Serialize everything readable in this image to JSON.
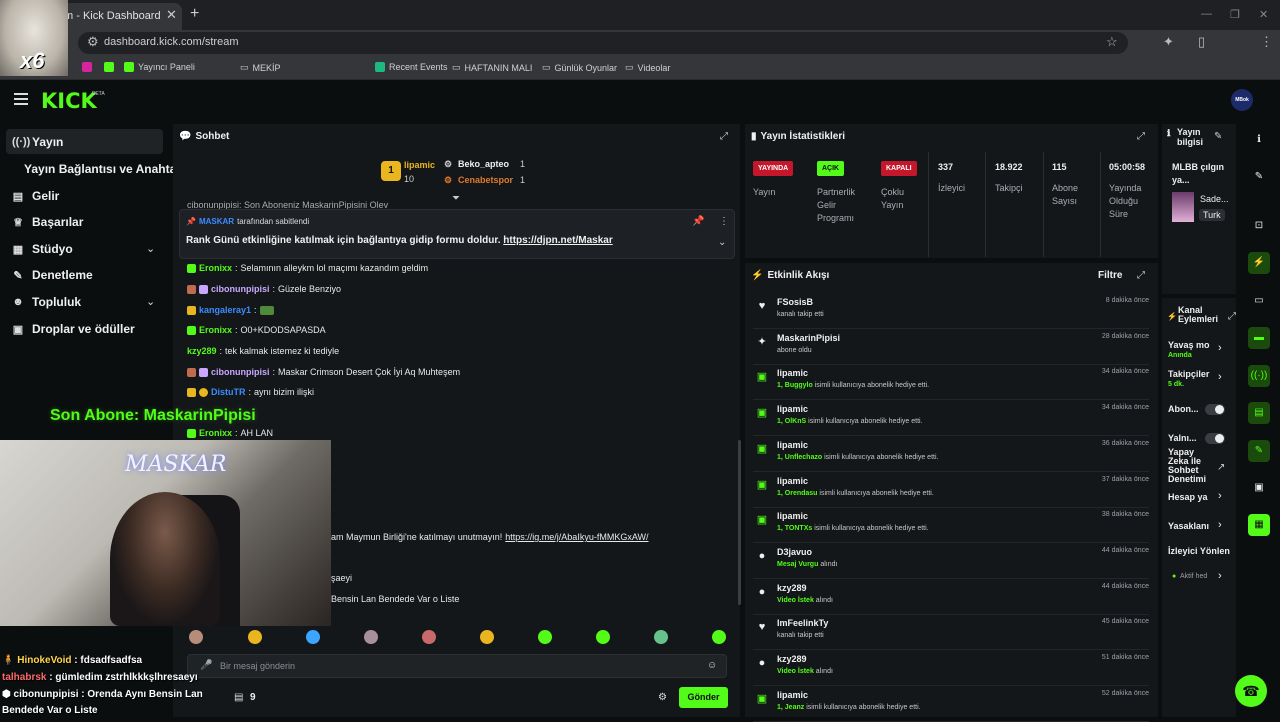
{
  "browser": {
    "tab_title": "m - Kick Dashboard",
    "url": "dashboard.kick.com/stream",
    "bookmarks": [
      "Yayıncı Paneli",
      "MEKİP",
      "Recent Events",
      "HAFTANIN MALI",
      "Günlük Oyunlar",
      "Videolar"
    ]
  },
  "app": {
    "logo": "KICK",
    "logo_beta": "BETA",
    "account_avatar": "MBok"
  },
  "sidebar": {
    "items": [
      {
        "label": "Yayın",
        "icon": "broadcast-icon"
      },
      {
        "label": "Yayın Bağlantısı ve Anahtarı",
        "icon": ""
      },
      {
        "label": "Gelir",
        "icon": "wallet-icon"
      },
      {
        "label": "Başarılar",
        "icon": "trophy-icon"
      },
      {
        "label": "Stüdyo",
        "icon": "studio-icon"
      },
      {
        "label": "Denetleme",
        "icon": "wrench-icon"
      },
      {
        "label": "Topluluk",
        "icon": "people-icon"
      },
      {
        "label": "Droplar ve ödüller",
        "icon": "gift-icon"
      }
    ]
  },
  "chat": {
    "title": "Sohbet",
    "top_gifters": {
      "rank": "1",
      "first": {
        "name": "lipamic",
        "count": "10"
      },
      "second": {
        "name": "Beko_apteo",
        "count": "1"
      },
      "third": {
        "name": "Cenabetspor",
        "count": "1"
      }
    },
    "cut_line": "cibonunpipisi: Son Aboneniz MaskarinPipisini Olev",
    "pinned": {
      "by_user": "MASKAR",
      "by_text": "tarafından sabitlendi",
      "message": "Rank Günü etkinliğine katılmak için bağlantıya gidip formu doldur. ",
      "link": "https://djpn.net/Maskar"
    },
    "messages": [
      {
        "user": "Eronixx",
        "text": "Selamının alleykm lol maçımı kazandım geldim",
        "color": "#53fc18"
      },
      {
        "user": "cibonunpipisi",
        "text": "Güzele Benziyo",
        "color": "#c9a7ff"
      },
      {
        "user": "kangaleray1",
        "text": "",
        "color": "#3b8cff"
      },
      {
        "user": "Eronixx",
        "text": "O0+KDODSAPASDA",
        "color": "#53fc18"
      },
      {
        "user": "kzy289",
        "text": "tek kalmak istemez ki tediyle",
        "color": "#53fc18"
      },
      {
        "user": "cibonunpipisi",
        "text": "Maskar Crimson Desert Çok İyi Aq Muhteşem",
        "color": "#c9a7ff"
      },
      {
        "user": "DistuTR",
        "text": "aynı bizim ilişki",
        "color": "#3b8cff"
      },
      {
        "user": "Eronixx",
        "text": "AH LAN",
        "color": "#53fc18"
      }
    ],
    "partial_lines": [
      {
        "text": "am Maymun Birliği'ne katılmayı unutmayın! ",
        "link": "https://ig.me/j/AbaIkyu-fMMKGxAW/"
      },
      {
        "text": "şaeyi",
        "link": ""
      },
      {
        "text": "Bensin Lan Bendede Var o Liste",
        "link": ""
      }
    ],
    "input_placeholder": "Bir mesaj gönderin",
    "points": "9",
    "send_label": "Gönder"
  },
  "stats": {
    "title": "Yayın İstatistikleri",
    "live_badge": "YAYINDA",
    "live_label": "Yayın",
    "partner_badge": "AÇIK",
    "partner_label": "Partnerlik Gelir Programı",
    "multi_badge": "KAPALI",
    "multi_label": "Çoklu Yayın",
    "viewers": "337",
    "viewers_label": "İzleyici",
    "followers": "18.922",
    "followers_label": "Takipçi",
    "subs": "115",
    "subs_label": "Abone Sayısı",
    "duration": "05:00:58",
    "duration_label": "Yayında Olduğu Süre"
  },
  "activity": {
    "title": "Etkinlik Akışı",
    "filter": "Filtre",
    "items": [
      {
        "icon": "heart-icon",
        "name": "FSosisB",
        "desc": "kanalı takip etti",
        "hl": "",
        "time": "8 dakika önce"
      },
      {
        "icon": "sparkle-icon",
        "name": "MaskarinPipisi",
        "desc": "abone oldu",
        "hl": "",
        "time": "28 dakika önce"
      },
      {
        "icon": "gift-icon",
        "name": "lipamic",
        "hl": "1, Buggylo",
        "desc": " isimli kullanıcıya abonelik hediye etti.",
        "time": "34 dakika önce"
      },
      {
        "icon": "gift-icon",
        "name": "lipamic",
        "hl": "1, OlKnS",
        "desc": " isimli kullanıcıya abonelik hediye etti.",
        "time": "34 dakika önce"
      },
      {
        "icon": "gift-icon",
        "name": "lipamic",
        "hl": "1, Unflechazo",
        "desc": " isimli kullanıcıya abonelik hediye etti.",
        "time": "36 dakika önce"
      },
      {
        "icon": "gift-icon",
        "name": "lipamic",
        "hl": "1, Orendasu",
        "desc": " isimli kullanıcıya abonelik hediye etti.",
        "time": "37 dakika önce"
      },
      {
        "icon": "gift-icon",
        "name": "lipamic",
        "hl": "1, TONTXs",
        "desc": " isimli kullanıcıya abonelik hediye etti.",
        "time": "38 dakika önce"
      },
      {
        "icon": "points-icon",
        "name": "D3javuo",
        "hl": "Mesaj Vurgu",
        "desc": " alındı",
        "time": "44 dakika önce"
      },
      {
        "icon": "points-icon",
        "name": "kzy289",
        "hl": "Video İstek",
        "desc": " alındı",
        "time": "44 dakika önce"
      },
      {
        "icon": "heart-icon",
        "name": "ImFeelinkTy",
        "desc": "kanalı takip etti",
        "hl": "",
        "time": "45 dakika önce"
      },
      {
        "icon": "points-icon",
        "name": "kzy289",
        "hl": "Video İstek",
        "desc": " alındı",
        "time": "51 dakika önce"
      },
      {
        "icon": "gift-icon",
        "name": "lipamic",
        "hl": "1, Jeanz",
        "desc": " isimli kullanıcıya abonelik hediye etti.",
        "time": "52 dakika önce"
      }
    ]
  },
  "stream_info": {
    "title": "Yayın bilgisi",
    "game_title": "MLBB çılgın ya...",
    "category": "Sade...",
    "tag": "Turk"
  },
  "channel_actions": {
    "title": "Kanal Eylemleri",
    "slow_mode": "Yavaş mo",
    "slow_mode_value": "Anında",
    "followers_only": "Takipçiler",
    "followers_only_value": "5 dk.",
    "subs_only": "Abon...",
    "emote_only": "Yalnı...",
    "ai_mod": "Yapay Zeka ile Sohbet Denetimi",
    "account_age": "Hesap ya",
    "bans": "Yasaklanı",
    "viewer_redirect": "İzleyici Yönlen",
    "active_status": "Aktif hed"
  },
  "overlay": {
    "multiplier": "x6",
    "cam_sign": "MASKAR",
    "last_sub": "Son Abone: MaskarinPipisi",
    "chat": [
      {
        "user": "HinokeVoid",
        "text": " : fdsadfsadfsa",
        "color": "#ffd84a"
      },
      {
        "user": "talhabrsk",
        "text": " : gümledim zstrhlkkkşlhresaeyı",
        "color": "#ff6a6a"
      },
      {
        "user": "cibonunpipisi",
        "text": " : Orenda Aynı Bensin Lan",
        "color": "#ffffff"
      },
      {
        "user": "",
        "text": "Bendede Var o Liste",
        "color": "#ffffff"
      }
    ]
  }
}
